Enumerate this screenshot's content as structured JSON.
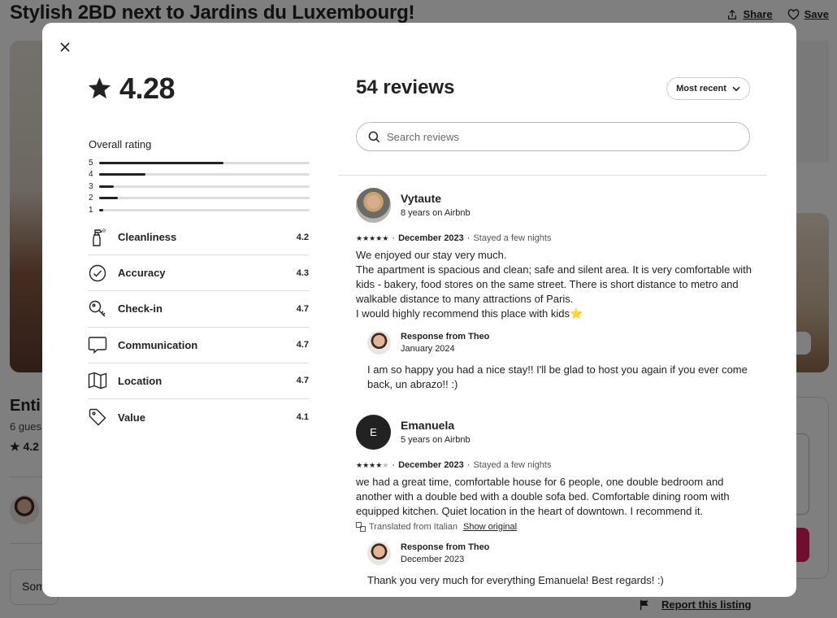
{
  "listing": {
    "title": "Stylish 2BD next to Jardins du Luxembourg!",
    "share_label": "Share",
    "save_label": "Save",
    "entire_label": "Enti",
    "guests_label": "6 gues",
    "rating_label": "4.2",
    "some_label": "Som",
    "report_label": "Report this listing"
  },
  "modal": {
    "rating": "4.28",
    "overall_label": "Overall rating",
    "distribution": [
      {
        "stars": "5",
        "fraction": 0.59
      },
      {
        "stars": "4",
        "fraction": 0.22
      },
      {
        "stars": "3",
        "fraction": 0.07
      },
      {
        "stars": "2",
        "fraction": 0.09
      },
      {
        "stars": "1",
        "fraction": 0.02
      }
    ],
    "categories": [
      {
        "name": "Cleanliness",
        "value": "4.2",
        "icon": "spray-bottle-icon"
      },
      {
        "name": "Accuracy",
        "value": "4.3",
        "icon": "check-circle-icon"
      },
      {
        "name": "Check-in",
        "value": "4.7",
        "icon": "key-icon"
      },
      {
        "name": "Communication",
        "value": "4.7",
        "icon": "chat-bubble-icon"
      },
      {
        "name": "Location",
        "value": "4.7",
        "icon": "map-icon"
      },
      {
        "name": "Value",
        "value": "4.1",
        "icon": "tag-icon"
      }
    ],
    "reviews_count_label": "54 reviews",
    "sort_label": "Most recent",
    "search_placeholder": "Search reviews",
    "reviews": [
      {
        "name": "Vytaute",
        "since": "8 years on Airbnb",
        "stars": 5,
        "date": "December 2023",
        "stay": "Stayed a few nights",
        "text": "We enjoyed our stay very much.\nThe apartment is spacious and clean; safe and silent area. It is very comfortable with kids - bakery, food stores on the same street. There is short distance to metro and walkable distance to many attractions of Paris.\nI would highly recommend this place with kids⭐",
        "response": {
          "from": "Response from Theo",
          "date": "January 2024",
          "text": "I am so happy you had a nice stay!! I'll be glad to host you again if you ever come back, un abrazo!! :)"
        }
      },
      {
        "name": "Emanuela",
        "initial": "E",
        "since": "5 years on Airbnb",
        "stars": 4,
        "date": "December 2023",
        "stay": "Stayed a few nights",
        "text": "we had a great time, comfortable house for 6 people, one double bedroom and another with a double bed with a double sofa bed. Comfortable dining room with equipped kitchen. Quiet location in the heart of downtown. I recommend it.",
        "translated_label": "Translated from Italian",
        "show_original_label": "Show original",
        "response": {
          "from": "Response from Theo",
          "date": "December 2023",
          "text": "Thank you very much for everything Emanuela! Best regards! :)"
        }
      }
    ]
  },
  "colors": {
    "accent": "#e31c5f",
    "text": "#222222",
    "overlay": "rgba(0,0,0,0.5)"
  }
}
